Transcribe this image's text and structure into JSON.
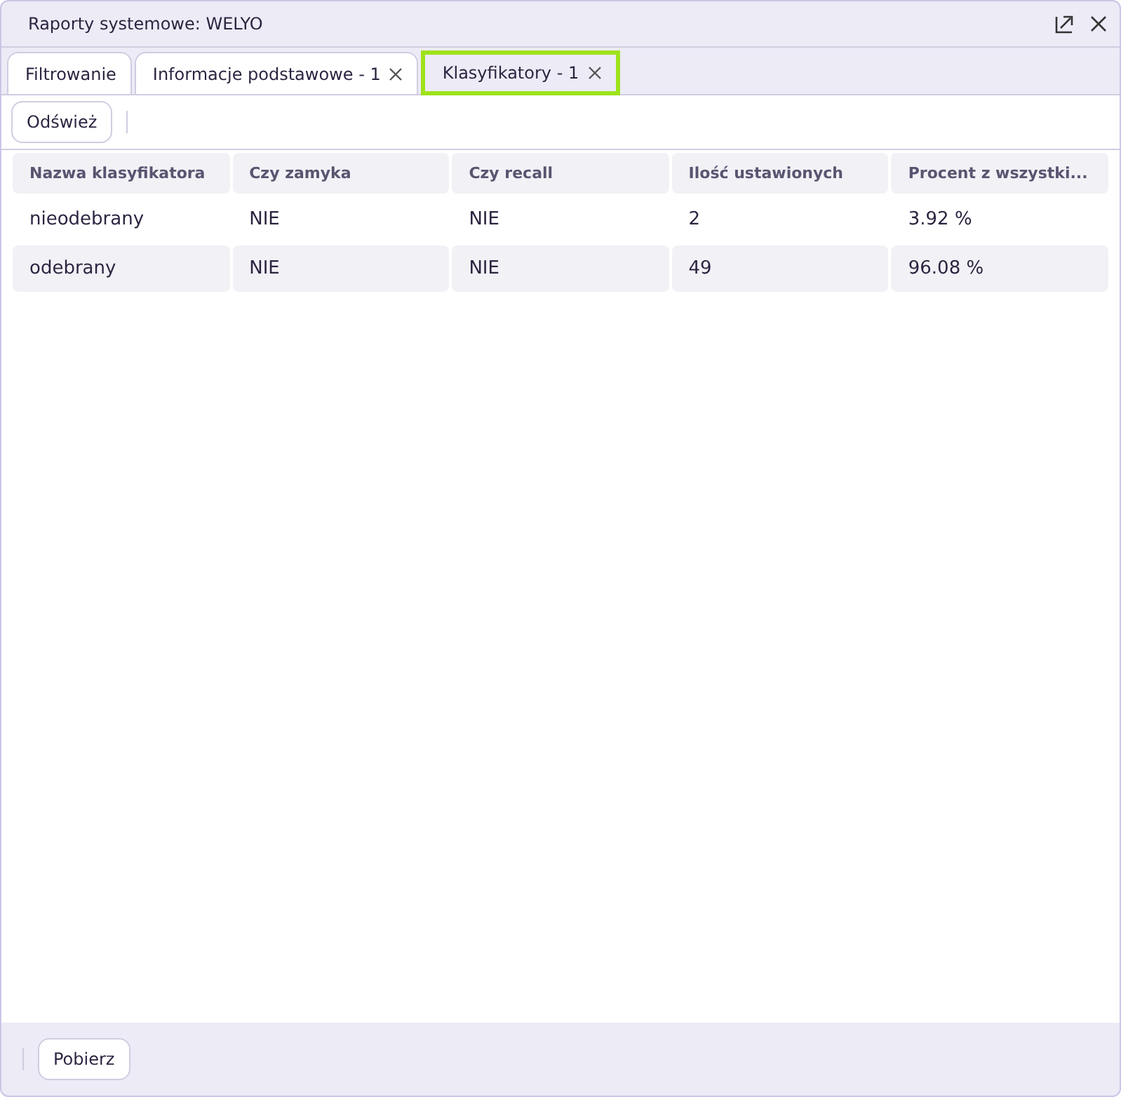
{
  "window": {
    "title": "Raporty systemowe: WELYO"
  },
  "tabs": [
    {
      "label": "Filtrowanie",
      "selected": false,
      "closable": false
    },
    {
      "label": "Informacje podstawowe - 1",
      "selected": false,
      "closable": true
    },
    {
      "label": "Klasyfikatory - 1",
      "selected": true,
      "closable": true
    }
  ],
  "toolbar": {
    "buttons": [
      "Odśwież"
    ]
  },
  "table": {
    "columns": [
      "Nazwa klasyfikatora",
      "Czy zamyka",
      "Czy recall",
      "Ilość ustawionych",
      "Procent z wszystki..."
    ],
    "rows": [
      [
        "nieodebrany",
        "NIE",
        "NIE",
        "2",
        "3.92 %"
      ],
      [
        "odebrany",
        "NIE",
        "NIE",
        "49",
        "96.08 %"
      ]
    ]
  },
  "footer": {
    "buttons": [
      "Pobierz"
    ]
  }
}
